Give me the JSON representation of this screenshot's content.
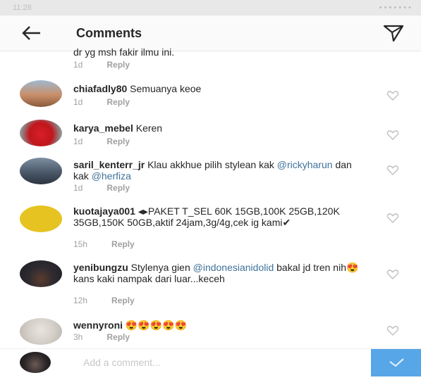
{
  "statusbar": {
    "left": "11:28",
    "right": "• • • • • • •"
  },
  "header": {
    "title": "Comments",
    "back_icon": "arrow-left-icon",
    "send_icon": "paper-plane-icon"
  },
  "comments": [
    {
      "user": "",
      "text": "dr yg msh fakir ilmu ini.",
      "time": "1d",
      "reply": "Reply"
    },
    {
      "user": "chiafadly80",
      "text": "Semuanya keoe",
      "time": "1d",
      "reply": "Reply"
    },
    {
      "user": "karya_mebel",
      "text": "Keren",
      "time": "1d",
      "reply": "Reply"
    },
    {
      "user": "saril_kenterr_jr",
      "text": "Klau akkhue pilih stylean kak",
      "mention1": "@rickyharun",
      "mid": "dan kak",
      "mention2": "@herfiza",
      "time": "1d",
      "reply": "Reply"
    },
    {
      "user": "kuotajaya001",
      "text": "◂▸PAKET T_SEL 60K 15GB,100K 25GB,120K 35GB,150K 50GB,aktif 24jam,3g/4g,cek ig kami✔",
      "time": "15h",
      "reply": "Reply"
    },
    {
      "user": "yenibungzu",
      "text": "Stylenya gien",
      "mention1": "@indonesianidolid",
      "rest": "bakal jd tren nih😍 kans kaki nampak dari luar...keceh",
      "time": "12h",
      "reply": "Reply"
    },
    {
      "user": "wennyroni",
      "text": "😍😍😍😍😍",
      "time": "3h",
      "reply": "Reply"
    }
  ],
  "composer": {
    "placeholder": "Add a comment...",
    "post_icon": "checkmark-icon"
  },
  "colors": {
    "link": "#3f729b",
    "post_button": "#57a6e7",
    "meta": "#a0a0a0"
  }
}
